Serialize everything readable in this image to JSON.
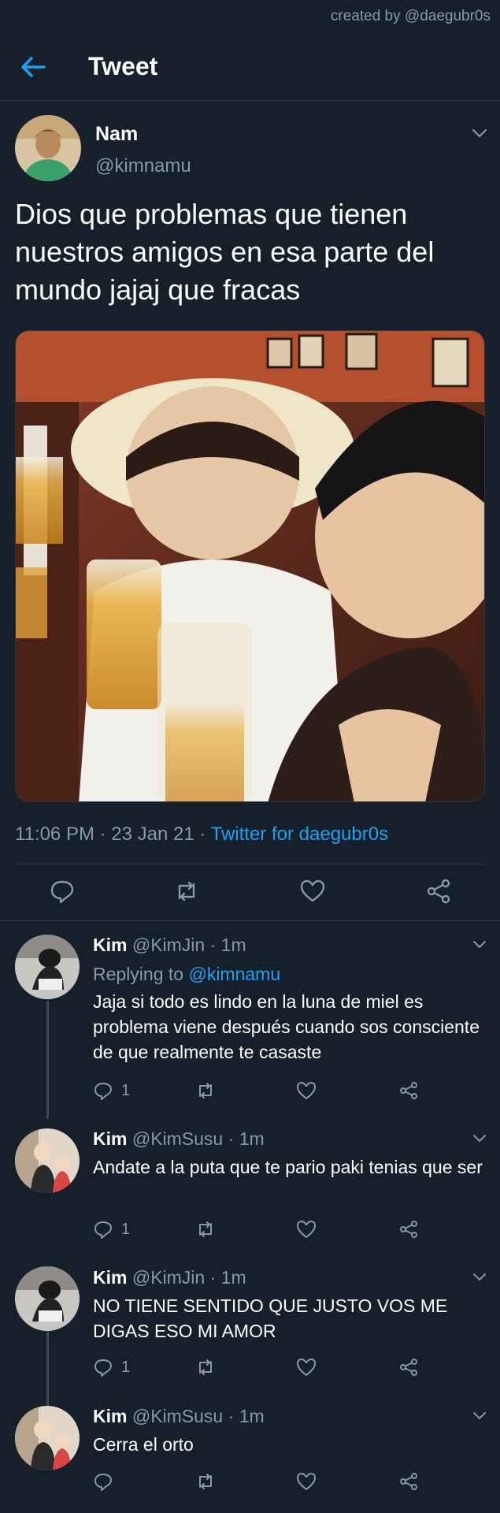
{
  "watermark": "created by @daegubr0s",
  "header": {
    "title": "Tweet",
    "back_icon": "back-arrow-icon"
  },
  "tweet": {
    "name": "Nam",
    "handle": "@kimnamu",
    "text": "Dios que problemas que tienen nuestros amigos en esa parte del mundo jajaj que fracas",
    "time": "11:06 PM",
    "date": "23 Jan 21",
    "separator": "·",
    "source": "Twitter for daegubr0s",
    "actions": [
      "reply-icon",
      "retweet-icon",
      "like-icon",
      "share-icon"
    ]
  },
  "replies": [
    {
      "name": "Kim",
      "handle": "@KimJin",
      "sep": "·",
      "time": "1m",
      "replying_prefix": "Replying to",
      "replying_to": "@kimnamu",
      "text": "Jaja si todo es lindo en la luna de miel es problema viene después cuando sos consciente de que realmente te casaste",
      "reply_count": "1"
    },
    {
      "name": "Kim",
      "handle": "@KimSusu",
      "sep": "·",
      "time": "1m",
      "text": "Andate a la puta que te pario paki tenias que ser",
      "reply_count": "1"
    },
    {
      "name": "Kim",
      "handle": "@KimJin",
      "sep": "·",
      "time": "1m",
      "text": "NO TIENE SENTIDO QUE JUSTO VOS ME DIGAS ESO MI AMOR",
      "reply_count": "1"
    },
    {
      "name": "Kim",
      "handle": "@KimSusu",
      "sep": "·",
      "time": "1m",
      "text": "Cerra el orto",
      "reply_count": ""
    }
  ],
  "colors": {
    "background": "#15202b",
    "accent": "#1da1f2",
    "muted": "#8899a6",
    "border": "#2a3640"
  }
}
